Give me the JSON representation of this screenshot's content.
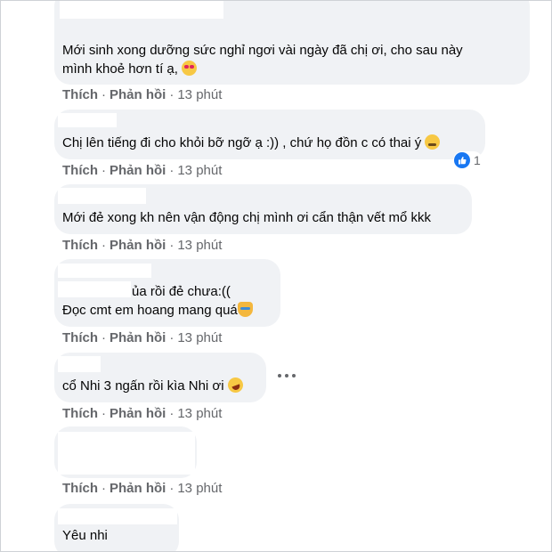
{
  "actions": {
    "like": "Thích",
    "separator": "·",
    "reply": "Phản hồi",
    "time": "13 phút"
  },
  "comments": [
    {
      "lines": [
        "Mới sinh xong dưỡng sức nghỉ ngơi vài ngày đã chị ơi, cho sau này",
        "mình khoẻ hơn tí ạ,"
      ],
      "emoji": "smiling-face-with-hearts-icon"
    },
    {
      "lines": [
        "Chị lên tiếng đi cho khỏi bỡ ngỡ ạ :)) , chứ họ đồn c có thai ý"
      ],
      "emoji": "sweat-smile-icon",
      "reaction": {
        "icon": "like-icon",
        "count": "1"
      }
    },
    {
      "lines": [
        "Mới đẻ xong kh nên vận động chị mình ơi cẩn thận vết mổ kkk"
      ]
    },
    {
      "lines": [
        "ủa rồi đẻ chưa:((",
        "Đọc cmt em hoang mang quá"
      ],
      "emoji": "crying-cat-icon"
    },
    {
      "lines": [
        "cổ Nhi 3 ngấn rồi kìa Nhi ơi"
      ],
      "emoji": "rolling-laughing-icon"
    },
    {
      "lines": []
    },
    {
      "lines": [
        "Yêu nhi"
      ]
    }
  ],
  "colors": {
    "bubble": "#f0f2f5",
    "secondary_text": "#65676b",
    "like_blue": "#1877f2"
  }
}
